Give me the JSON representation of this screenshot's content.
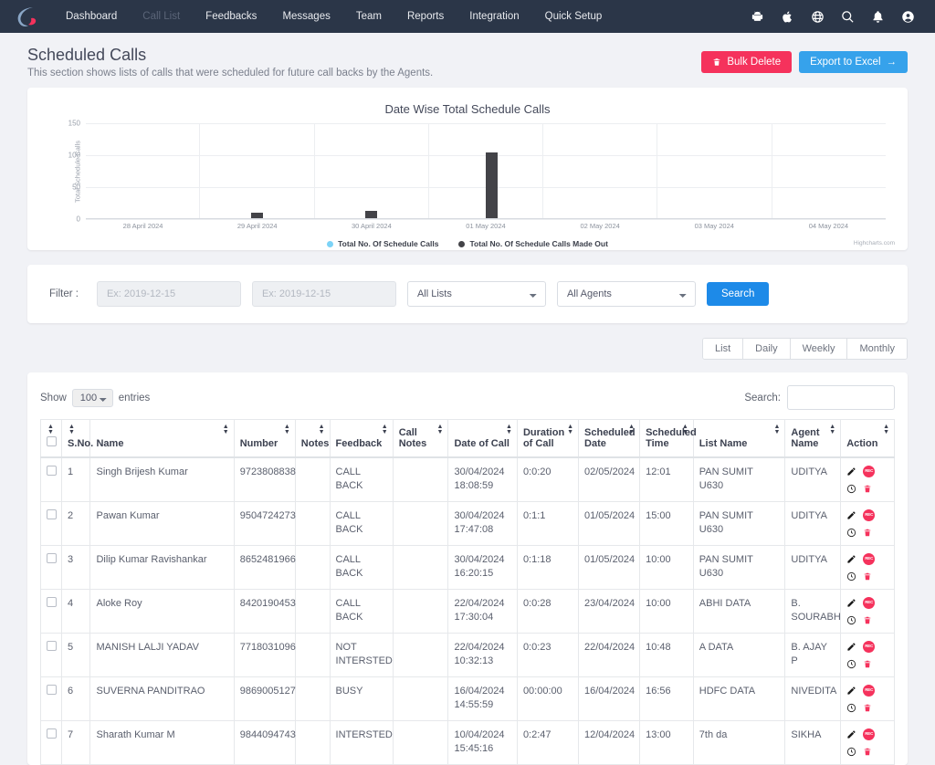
{
  "navbar": {
    "logo_name": "brand-logo",
    "links": [
      {
        "label": "Dashboard",
        "dim": false
      },
      {
        "label": "Call List",
        "dim": true
      },
      {
        "label": "Feedbacks",
        "dim": false
      },
      {
        "label": "Messages",
        "dim": false
      },
      {
        "label": "Team",
        "dim": false
      },
      {
        "label": "Reports",
        "dim": false
      },
      {
        "label": "Integration",
        "dim": false
      },
      {
        "label": "Quick Setup",
        "dim": false
      }
    ],
    "icons": [
      "android-icon",
      "apple-icon",
      "globe-icon",
      "search-icon",
      "bell-icon",
      "user-account-icon"
    ]
  },
  "page": {
    "title": "Scheduled Calls",
    "subtitle": "This section shows lists of calls that were scheduled for future call backs by the Agents.",
    "bulk_delete_label": "Bulk Delete",
    "export_label": "Export to Excel",
    "export_arrow": "→",
    "trash_icon": "trash-icon"
  },
  "chart_data": {
    "type": "bar",
    "title": "Date Wise Total Schedule Calls",
    "xlabel": "",
    "ylabel": "Total Schedule Calls",
    "categories": [
      "28 April 2024",
      "29 April 2024",
      "30 April 2024",
      "01 May 2024",
      "02 May 2024",
      "03 May 2024",
      "04 May 2024"
    ],
    "yticks": [
      0,
      50,
      100,
      150
    ],
    "ylim": [
      0,
      150
    ],
    "grid": true,
    "legend_position": "bottom",
    "credits": "Highcharts.com",
    "series": [
      {
        "name": "Total No. Of Schedule Calls",
        "color": "#7cd3f7",
        "values": [
          0,
          0,
          0,
          2,
          0,
          0,
          0
        ]
      },
      {
        "name": "Total No. Of Schedule Calls Made Out",
        "color": "#434348",
        "values": [
          0,
          10,
          13,
          105,
          0,
          0,
          0
        ]
      }
    ]
  },
  "filter": {
    "label": "Filter :",
    "date_from_placeholder": "Ex: 2019-12-15",
    "date_from_value": "",
    "date_to_placeholder": "Ex: 2019-12-15",
    "date_to_value": "",
    "lists_selected": "All Lists",
    "agents_selected": "All Agents",
    "search_label": "Search"
  },
  "view_toggle": {
    "items": [
      "List",
      "Daily",
      "Weekly",
      "Monthly"
    ]
  },
  "table_controls": {
    "show_label": "Show",
    "entries_value": "100",
    "entries_label": "entries",
    "search_label": "Search:",
    "search_value": ""
  },
  "table": {
    "columns": [
      "S.No.",
      "Name",
      "Number",
      "Notes",
      "Feedback",
      "Call Notes",
      "Date of Call",
      "Duration of Call",
      "Scheduled Date",
      "Scheduled Time",
      "List Name",
      "Agent Name",
      "Action"
    ],
    "rows": [
      {
        "sno": "1",
        "name": "Singh Brijesh Kumar",
        "number": "9723808838",
        "notes": "",
        "feedback": "CALL BACK",
        "call_notes": "",
        "date_of_call": "30/04/2024 18:08:59",
        "duration": "0:0:20",
        "sched_date": "02/05/2024",
        "sched_time": "12:01",
        "list_name": "PAN SUMIT U630",
        "agent": "UDITYA"
      },
      {
        "sno": "2",
        "name": "Pawan Kumar",
        "number": "9504724273",
        "notes": "",
        "feedback": "CALL BACK",
        "call_notes": "",
        "date_of_call": "30/04/2024 17:47:08",
        "duration": "0:1:1",
        "sched_date": "01/05/2024",
        "sched_time": "15:00",
        "list_name": "PAN SUMIT U630",
        "agent": "UDITYA"
      },
      {
        "sno": "3",
        "name": "Dilip Kumar Ravishankar",
        "number": "8652481966",
        "notes": "",
        "feedback": "CALL BACK",
        "call_notes": "",
        "date_of_call": "30/04/2024 16:20:15",
        "duration": "0:1:18",
        "sched_date": "01/05/2024",
        "sched_time": "10:00",
        "list_name": "PAN SUMIT U630",
        "agent": "UDITYA"
      },
      {
        "sno": "4",
        "name": "Aloke Roy",
        "number": "8420190453",
        "notes": "",
        "feedback": "CALL BACK",
        "call_notes": "",
        "date_of_call": "22/04/2024 17:30:04",
        "duration": "0:0:28",
        "sched_date": "23/04/2024",
        "sched_time": "10:00",
        "list_name": "ABHI DATA",
        "agent": "B. SOURABH"
      },
      {
        "sno": "5",
        "name": "MANISH LALJI YADAV",
        "number": "7718031096",
        "notes": "",
        "feedback": "NOT INTERSTED",
        "call_notes": "",
        "date_of_call": "22/04/2024 10:32:13",
        "duration": "0:0:23",
        "sched_date": "22/04/2024",
        "sched_time": "10:48",
        "list_name": "A DATA",
        "agent": "B. AJAY P"
      },
      {
        "sno": "6",
        "name": "SUVERNA PANDITRAO",
        "number": "9869005127",
        "notes": "",
        "feedback": "BUSY",
        "call_notes": "",
        "date_of_call": "16/04/2024 14:55:59",
        "duration": "00:00:00",
        "sched_date": "16/04/2024",
        "sched_time": "16:56",
        "list_name": "HDFC DATA",
        "agent": "NIVEDITA"
      },
      {
        "sno": "7",
        "name": "Sharath Kumar M",
        "number": "9844094743",
        "notes": "",
        "feedback": "INTERSTED",
        "call_notes": "",
        "date_of_call": "10/04/2024 15:45:16",
        "duration": "0:2:47",
        "sched_date": "12/04/2024",
        "sched_time": "13:00",
        "list_name": "7th da",
        "agent": "SIKHA"
      }
    ],
    "action_icons": [
      "edit-pencil-icon",
      "recording-icon",
      "history-clock-icon",
      "delete-trash-icon"
    ],
    "recording_badge_text": "REC"
  }
}
